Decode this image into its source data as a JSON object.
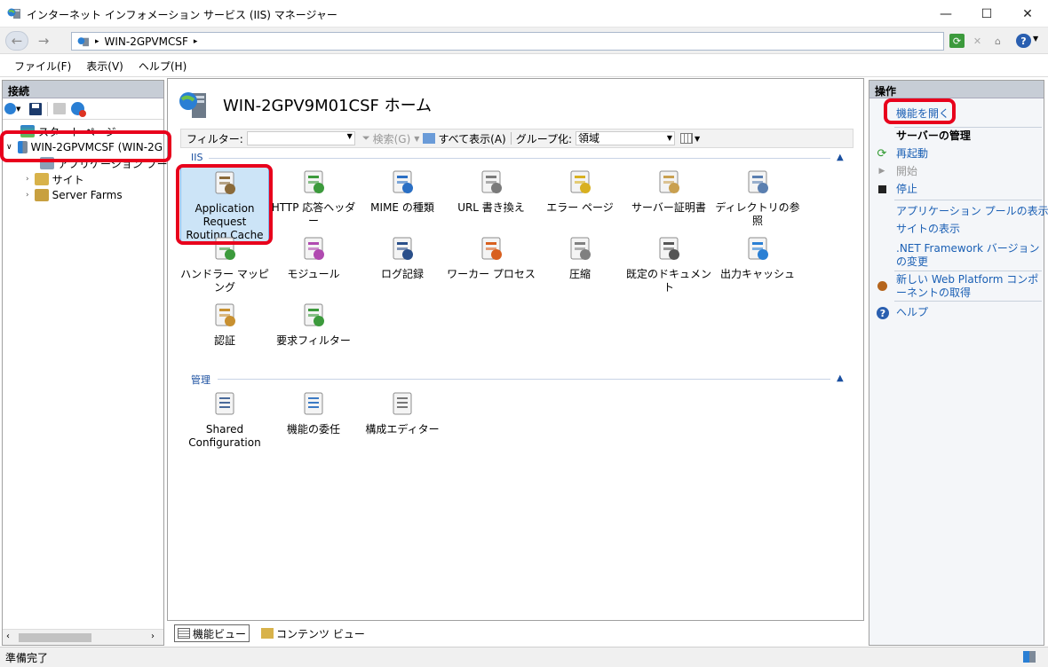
{
  "window": {
    "title": "インターネット インフォメーション サービス (IIS) マネージャー",
    "minimize": "—",
    "maximize": "☐",
    "close": "✕"
  },
  "address": {
    "back": "←",
    "forward": "→",
    "path": "WIN-2GPVMCSF",
    "sep": "▸"
  },
  "menu": {
    "file": "ファイル(F)",
    "view": "表示(V)",
    "help": "ヘルプ(H)"
  },
  "connections": {
    "title": "接続",
    "tree": [
      {
        "label": "スタート ページ"
      },
      {
        "label": "WIN-2GPVMCSF (WIN-2G"
      },
      {
        "label": "アプリケーション プール"
      },
      {
        "label": "サイト"
      },
      {
        "label": "Server Farms"
      }
    ]
  },
  "center": {
    "title": "WIN-2GPV9M01CSF ホーム",
    "filter_label": "フィルター:",
    "search": "検索(G)",
    "show_all": "すべて表示(A)",
    "group_by": "グループ化:",
    "group_value": "領域",
    "groups": [
      {
        "name": "IIS",
        "features": [
          "Application Request Routing Cache",
          "HTTP 応答ヘッダー",
          "MIME の種類",
          "URL 書き換え",
          "エラー ページ",
          "サーバー証明書",
          "ディレクトリの参照",
          "ハンドラー マッピング",
          "モジュール",
          "ログ記録",
          "ワーカー プロセス",
          "圧縮",
          "既定のドキュメント",
          "出力キャッシュ",
          "認証",
          "要求フィルター"
        ]
      },
      {
        "name": "管理",
        "features": [
          "Shared Configuration",
          "機能の委任",
          "構成エディター"
        ]
      }
    ],
    "tab_features": "機能ビュー",
    "tab_content": "コンテンツ ビュー"
  },
  "actions": {
    "title": "操作",
    "open_feature": "機能を開く",
    "server_mgmt": "サーバーの管理",
    "restart": "再起動",
    "start": "開始",
    "stop": "停止",
    "view_pools": "アプリケーション プールの表示",
    "view_sites": "サイトの表示",
    "change_net": ".NET Framework バージョンの変更",
    "get_web_platform": "新しい Web Platform コンポーネントの取得",
    "help": "ヘルプ"
  },
  "status": {
    "text": "準備完了"
  },
  "colors": {
    "accent": "#1a5fb4",
    "highlight": "#e8001c",
    "selection": "#cce4f7"
  }
}
